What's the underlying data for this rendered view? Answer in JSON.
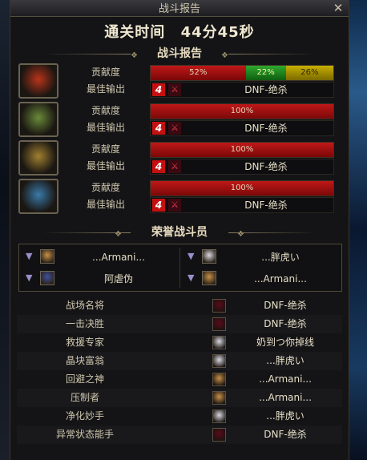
{
  "window": {
    "title": "战斗报告",
    "close_glyph": "✕"
  },
  "clear_time": {
    "label": "通关时间",
    "value": "44分45秒"
  },
  "battle_report": {
    "header": "战斗报告",
    "contribution_label": "贡献度",
    "best_output_label": "最佳输出",
    "players": [
      {
        "portrait": "red-flame-icon",
        "color": "#b8341a",
        "segments": [
          {
            "pct": 52,
            "label": "52%",
            "color": "red"
          },
          {
            "pct": 22,
            "label": "22%",
            "color": "green"
          },
          {
            "pct": 26,
            "label": "26%",
            "color": "yellow"
          }
        ],
        "best_output": "DNF-绝杀"
      },
      {
        "portrait": "green-helm-icon",
        "color": "#6a8a3a",
        "segments": [
          {
            "pct": 100,
            "label": "100%",
            "color": "red"
          }
        ],
        "best_output": "DNF-绝杀"
      },
      {
        "portrait": "gold-helm-icon",
        "color": "#a08030",
        "segments": [
          {
            "pct": 100,
            "label": "100%",
            "color": "red"
          }
        ],
        "best_output": "DNF-绝杀"
      },
      {
        "portrait": "blue-helm-icon",
        "color": "#3a7aa8",
        "segments": [
          {
            "pct": 100,
            "label": "100%",
            "color": "red"
          }
        ],
        "best_output": "DNF-绝杀"
      }
    ]
  },
  "honor": {
    "header": "荣誉战斗员",
    "members": [
      {
        "name": "...Armani...",
        "avatar_color": "#c89048"
      },
      {
        "name": "...胖虎い",
        "avatar_color": "#d8d8e0"
      },
      {
        "name": "阿虐伪",
        "avatar_color": "#4050a0"
      },
      {
        "name": "...Armani...",
        "avatar_color": "#c89048"
      }
    ]
  },
  "awards": [
    {
      "title": "战场名将",
      "name": "DNF-绝杀",
      "icon_color": "#5a0a1a"
    },
    {
      "title": "一击决胜",
      "name": "DNF-绝杀",
      "icon_color": "#5a0a1a"
    },
    {
      "title": "救援专家",
      "name": "奶到つ你掉线",
      "icon_color": "#d8d8e0"
    },
    {
      "title": "晶块富翁",
      "name": "...胖虎い",
      "icon_color": "#d8d8e0"
    },
    {
      "title": "回避之神",
      "name": "...Armani...",
      "icon_color": "#c89048"
    },
    {
      "title": "压制者",
      "name": "...Armani...",
      "icon_color": "#c89048"
    },
    {
      "title": "净化妙手",
      "name": "...胖虎い",
      "icon_color": "#d8d8e0"
    },
    {
      "title": "异常状态能手",
      "name": "DNF-绝杀",
      "icon_color": "#5a0a1a"
    }
  ]
}
